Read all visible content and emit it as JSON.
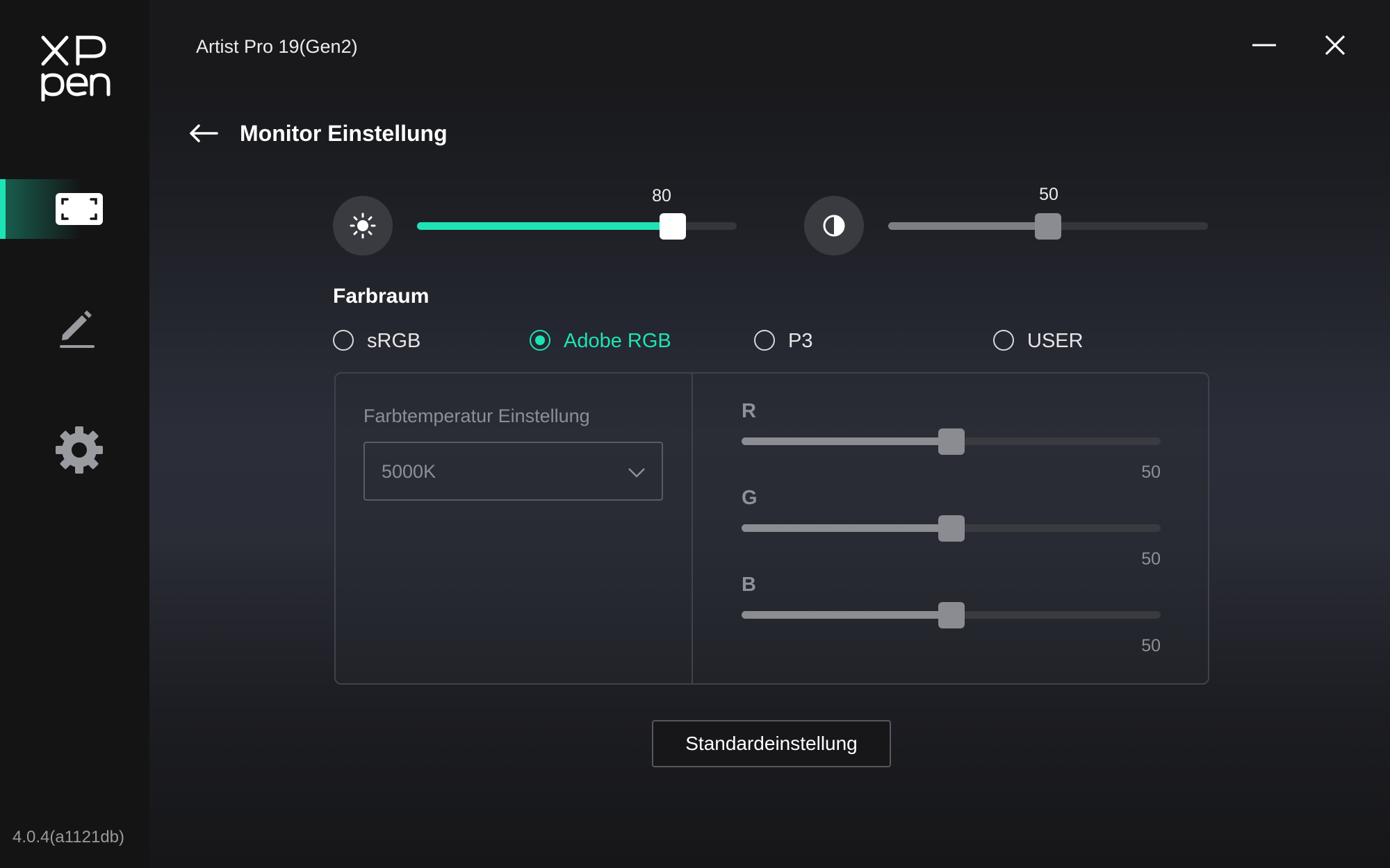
{
  "app": {
    "logo_text_top": "XP",
    "logo_text_bottom": "pen",
    "version": "4.0.4(a1121db)",
    "window_title": "Artist Pro 19(Gen2)"
  },
  "sidebar": {
    "items": [
      {
        "icon": "monitor-frame-icon",
        "active": true
      },
      {
        "icon": "pen-icon",
        "active": false
      },
      {
        "icon": "gear-icon",
        "active": false
      }
    ]
  },
  "page": {
    "title": "Monitor Einstellung"
  },
  "brightness": {
    "icon": "brightness-icon",
    "value": "80",
    "level": 80
  },
  "contrast": {
    "icon": "contrast-icon",
    "value": "50",
    "level": 50
  },
  "colorspace": {
    "label": "Farbraum",
    "options": [
      "sRGB",
      "Adobe RGB",
      "P3",
      "USER"
    ],
    "selected": "Adobe RGB"
  },
  "color_temp": {
    "label": "Farbtemperatur Einstellung",
    "value": "5000K"
  },
  "rgb": {
    "r": {
      "label": "R",
      "value": "50",
      "level": 50
    },
    "g": {
      "label": "G",
      "value": "50",
      "level": 50
    },
    "b": {
      "label": "B",
      "value": "50",
      "level": 50
    }
  },
  "default_button": "Standardeinstellung",
  "colors": {
    "accent": "#1ee3b5",
    "background": "#141416",
    "text_disabled": "#8d8f96"
  }
}
